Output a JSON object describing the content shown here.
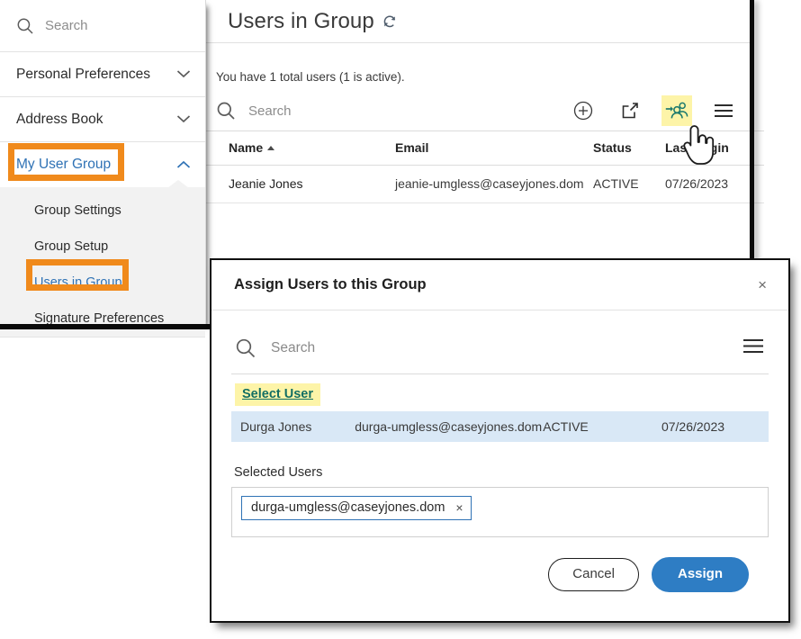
{
  "sidebar": {
    "search": {
      "placeholder": "Search",
      "icon": "search-icon"
    },
    "items": [
      {
        "label": "Personal Preferences",
        "icon": "chevron-down-icon",
        "expanded": false
      },
      {
        "label": "Address Book",
        "icon": "chevron-down-icon",
        "expanded": false
      },
      {
        "label": "My User Group",
        "icon": "chevron-up-icon",
        "expanded": true,
        "highlighted": true
      }
    ],
    "submenu": [
      {
        "label": "Group Settings",
        "selected": false
      },
      {
        "label": "Group Setup",
        "selected": false
      },
      {
        "label": "Users in Group",
        "selected": true
      },
      {
        "label": "Signature Preferences",
        "selected": false
      }
    ]
  },
  "main": {
    "title": "Users in Group",
    "refresh_icon": "refresh-icon",
    "summary": "You have 1 total users (1 is active).",
    "search": {
      "placeholder": "Search",
      "icon": "search-icon"
    },
    "toolbar": [
      {
        "name": "add-icon",
        "label": "Add",
        "highlighted": false
      },
      {
        "name": "share-export-icon",
        "label": "Export",
        "highlighted": false
      },
      {
        "name": "assign-users-icon",
        "label": "Assign Users",
        "highlighted": true
      },
      {
        "name": "hamburger-menu-icon",
        "label": "Menu",
        "highlighted": false
      }
    ],
    "table": {
      "columns": [
        "Name",
        "Email",
        "Status",
        "Last Login"
      ],
      "sort_column": "Name",
      "sort_direction": "asc",
      "rows": [
        {
          "name": "Jeanie Jones",
          "email": "jeanie-umgless@caseyjones.dom",
          "status": "ACTIVE",
          "last_login": "07/26/2023"
        }
      ]
    }
  },
  "modal": {
    "title": "Assign Users to this Group",
    "close_label": "×",
    "search": {
      "placeholder": "Search",
      "icon": "search-icon"
    },
    "menu_icon": "hamburger-menu-icon",
    "select_user_link": "Select User",
    "result_row": {
      "name": "Durga Jones",
      "email": "durga-umgless@caseyjones.dom",
      "status": "ACTIVE",
      "last_login": "07/26/2023"
    },
    "selected_users_label": "Selected Users",
    "chips": [
      {
        "label": "durga-umgless@caseyjones.dom",
        "remove_label": "×"
      }
    ],
    "cancel_label": "Cancel",
    "assign_label": "Assign"
  },
  "colors": {
    "annotation": "#f08a1c",
    "highlight": "#fdf4a8",
    "link": "#2f72b5",
    "assign_button": "#2e7dc4",
    "selected_row": "#d9e8f6",
    "teal_link": "#126e63",
    "icon_teal": "#1d7a6e"
  }
}
